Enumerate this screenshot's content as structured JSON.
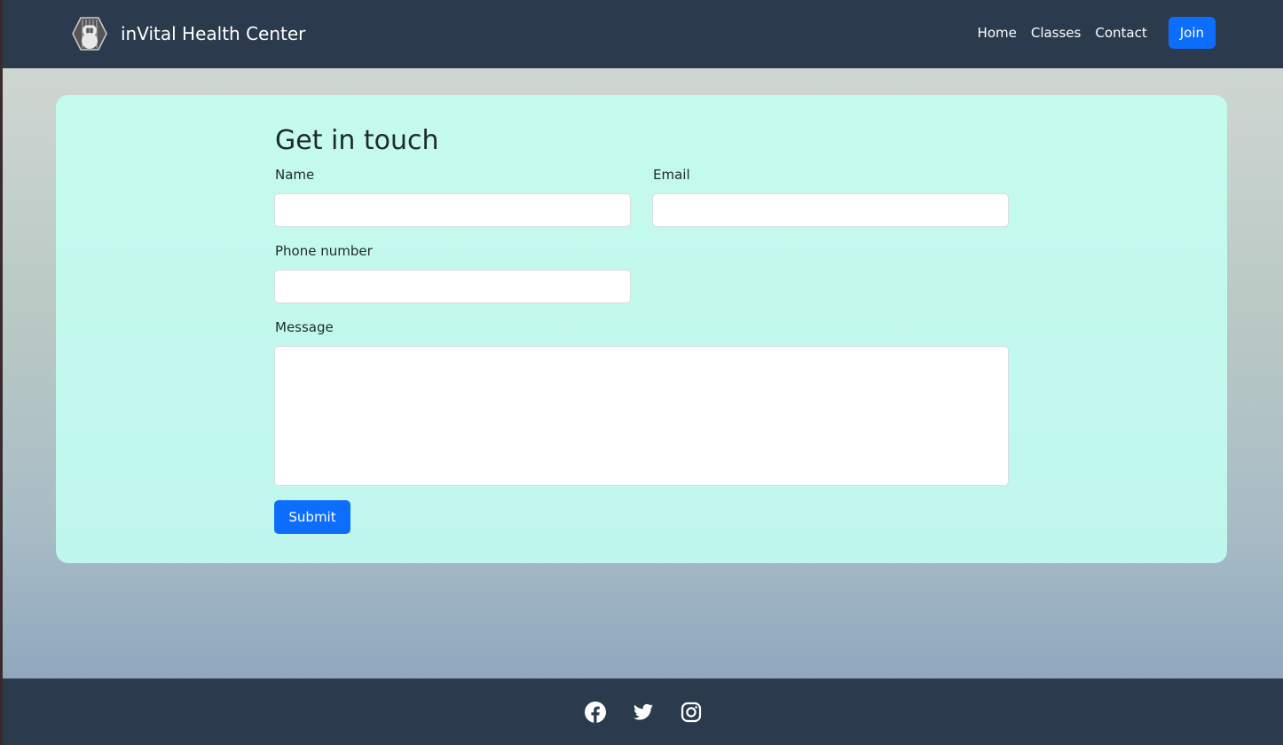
{
  "nav": {
    "brand": "inVital Health Center",
    "links": [
      "Home",
      "Classes",
      "Contact"
    ],
    "join": "Join"
  },
  "form": {
    "title": "Get in touch",
    "name_label": "Name",
    "email_label": "Email",
    "phone_label": "Phone number",
    "message_label": "Message",
    "submit": "Submit"
  },
  "footer": {
    "icons": [
      "facebook-icon",
      "twitter-icon",
      "instagram-icon"
    ]
  }
}
